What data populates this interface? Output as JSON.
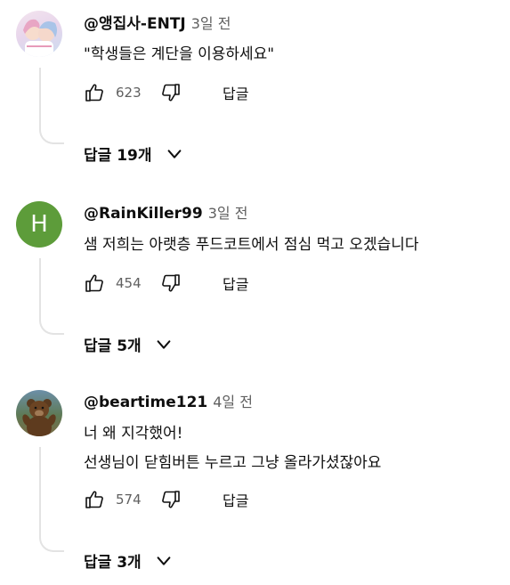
{
  "comments": [
    {
      "author": "@앵집사-ENTJ",
      "time": "3일 전",
      "lines": [
        "\"학생들은 계단을 이용하세요\""
      ],
      "likes": "623",
      "reply_label": "답글",
      "replies_label": "답글 19개",
      "avatar_type": "anime-illustration"
    },
    {
      "author": "@RainKiller99",
      "time": "3일 전",
      "lines": [
        "샘 저희는 아랫층 푸드코트에서 점심 먹고 오겠습니다"
      ],
      "likes": "454",
      "reply_label": "답글",
      "replies_label": "답글 5개",
      "avatar_letter": "H",
      "avatar_color": "#5d9c3a"
    },
    {
      "author": "@beartime121",
      "time": "4일 전",
      "lines": [
        "너 왜 지각했어!",
        "선생님이 닫힘버튼 누르고 그냥 올라가셨잖아요"
      ],
      "likes": "574",
      "reply_label": "답글",
      "replies_label": "답글 3개",
      "avatar_type": "bear-photo"
    }
  ],
  "icons": {
    "like": "thumbs-up-icon",
    "dislike": "thumbs-down-icon",
    "expand": "chevron-down-icon"
  },
  "colors": {
    "text": "#0f0f0f",
    "secondary": "#606060",
    "thread_line": "#e3e3e3"
  }
}
